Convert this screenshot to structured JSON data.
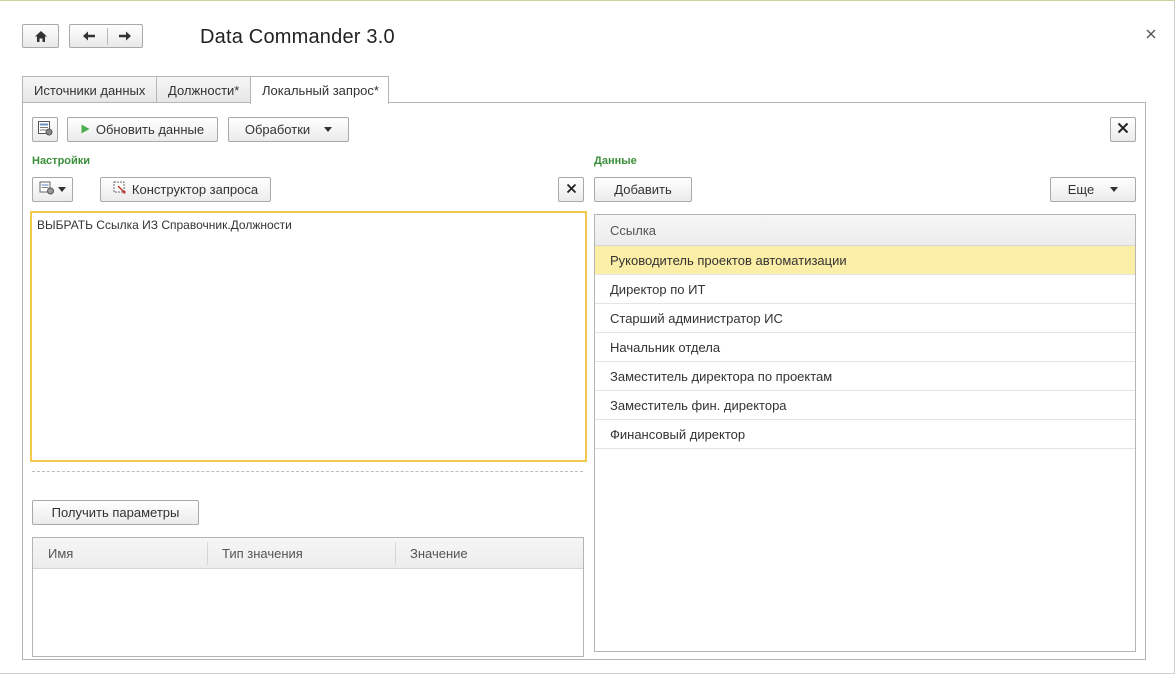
{
  "window": {
    "title": "Data Commander 3.0",
    "icons": {
      "home": "home-icon",
      "back": "arrow-left-icon",
      "forward": "arrow-right-icon",
      "close": "close-icon"
    }
  },
  "tabs": [
    {
      "label": "Источники данных",
      "active": false
    },
    {
      "label": "Должности*",
      "active": false
    },
    {
      "label": "Локальный запрос*",
      "active": true
    }
  ],
  "toolbar": {
    "settings_icon": "form-settings-icon",
    "refresh_label": "Обновить данные",
    "refresh_icon": "play-icon",
    "processing_label": "Обработки",
    "close_icon": "close-icon"
  },
  "settings": {
    "section_title": "Настройки",
    "query_menu_icon": "query-options-icon",
    "constructor_label": "Конструктор запроса",
    "constructor_icon": "query-constructor-icon",
    "clear_icon": "close-icon",
    "query_text": "ВЫБРАТЬ Ссылка ИЗ Справочник.Должности",
    "get_params_label": "Получить параметры",
    "params_columns": [
      "Имя",
      "Тип значения",
      "Значение"
    ]
  },
  "data": {
    "section_title": "Данные",
    "add_label": "Добавить",
    "more_label": "Еще",
    "column": "Ссылка",
    "rows": [
      "Руководитель проектов автоматизации",
      "Директор по ИТ",
      "Старший администратор ИС",
      "Начальник отдела",
      "Заместитель директора по проектам",
      "Заместитель фин. директора",
      "Финансовый директор"
    ],
    "selected_index": 0
  },
  "colors": {
    "accent_green": "#3a8f3a",
    "selection": "#fbeea6",
    "editor_border": "#f2c94c",
    "play_green": "#4caf50"
  }
}
